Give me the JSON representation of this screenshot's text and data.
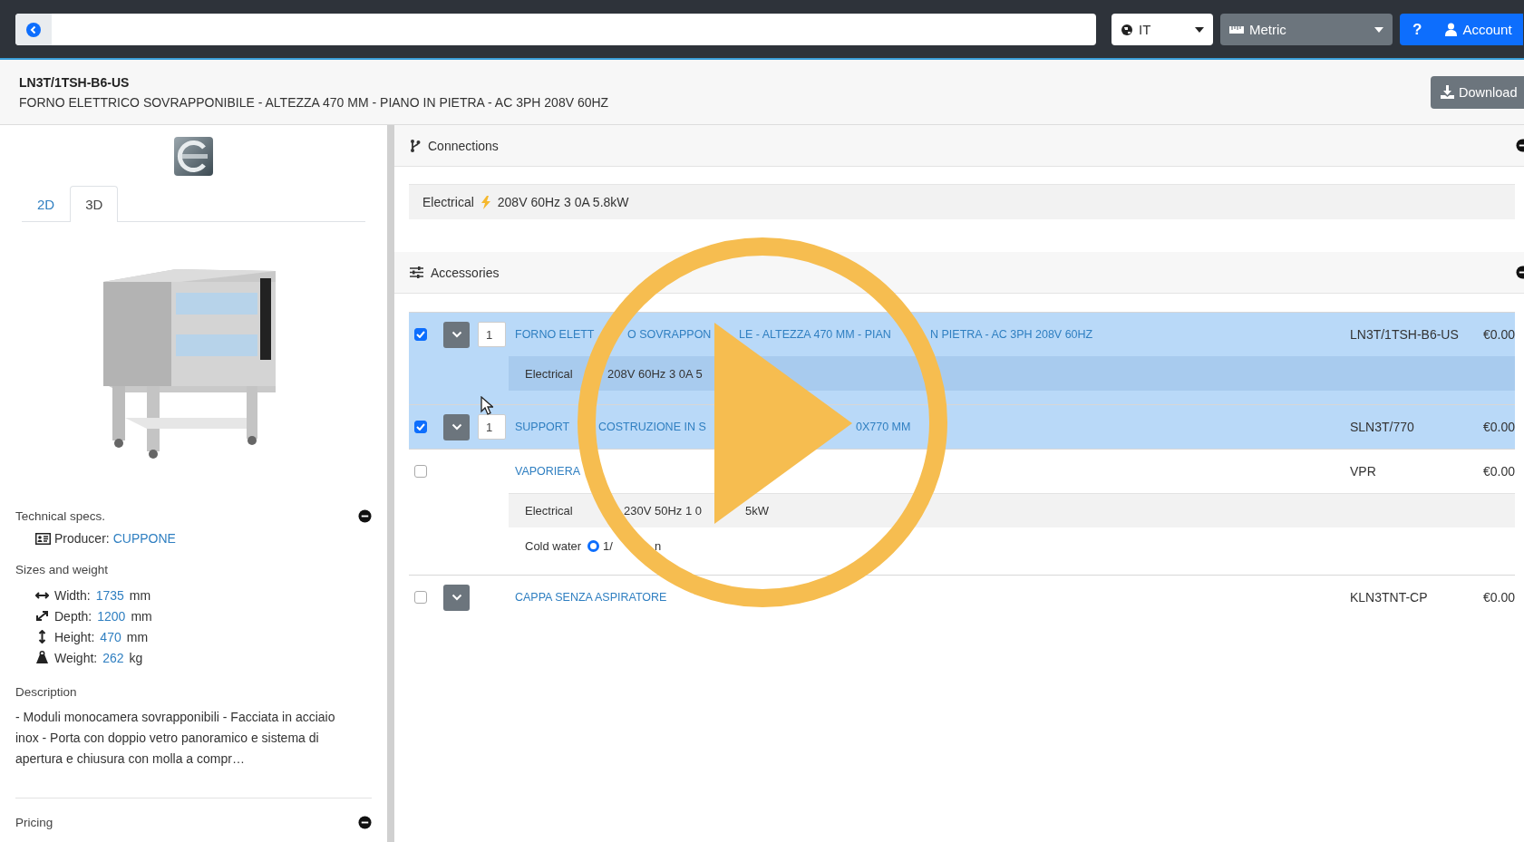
{
  "top_bar": {
    "language": "IT",
    "units": "Metric",
    "help": "?",
    "account": "Account"
  },
  "product": {
    "code": "LN3T/1TSH-B6-US",
    "name": "FORNO ELETTRICO SOVRAPPONIBILE - ALTEZZA 470 MM - PIANO IN PIETRA - AC 3PH 208V 60HZ",
    "download": "Download"
  },
  "viewer_tabs": [
    {
      "label": "2D",
      "selected": false
    },
    {
      "label": "3D",
      "selected": true
    }
  ],
  "technical_specs": {
    "title": "Technical specs.",
    "expanded": true,
    "producer_label": "Producer:",
    "producer": "CUPPONE"
  },
  "sizes": {
    "title": "Sizes and weight",
    "items": [
      {
        "kind": "width",
        "label": "Width:",
        "value": "1735",
        "unit": "mm"
      },
      {
        "kind": "depth",
        "label": "Depth:",
        "value": "1200",
        "unit": "mm"
      },
      {
        "kind": "height",
        "label": "Height:",
        "value": "470",
        "unit": "mm"
      },
      {
        "kind": "weight",
        "label": "Weight:",
        "value": "262",
        "unit": "kg"
      }
    ]
  },
  "description": {
    "title": "Description",
    "text": "- Moduli monocamera sovrapponibili - Facciata in acciaio inox - Porta con doppio vetro panoramico e sistema di apertura e chiusura con molla a compr…"
  },
  "pricing": {
    "title": "Pricing",
    "expanded": true
  },
  "connections": {
    "title": "Connections",
    "expanded": true,
    "items": [
      {
        "label": "Electrical",
        "value": "208V 60Hz 3 0A 5.8kW"
      }
    ]
  },
  "accessories": {
    "title": "Accessories",
    "expanded": true,
    "rows": [
      {
        "checked": true,
        "toggle": true,
        "quantity": "1",
        "title_parts": [
          "FORNO ELETT",
          "O SOVRAPPON",
          "LE - ALTEZZA 470 MM - PIAN",
          "N PIETRA - AC 3PH 208V 60HZ"
        ],
        "code": "LN3T/1TSH-B6-US",
        "price": "€0.00",
        "details": [
          {
            "kind": "electrical",
            "label": "Electrical",
            "parts": [
              "208V 60Hz 3 0A 5"
            ]
          }
        ]
      },
      {
        "checked": true,
        "toggle": true,
        "quantity": "1",
        "title_parts": [
          "SUPPORT",
          "COSTRUZIONE IN S",
          "0X770 MM"
        ],
        "code": "SLN3T/770",
        "price": "€0.00",
        "details": []
      },
      {
        "checked": false,
        "toggle": false,
        "title_parts": [
          "VAPORIERA"
        ],
        "code": "VPR",
        "price": "€0.00",
        "details": [
          {
            "kind": "electrical",
            "label": "Electrical",
            "parts": [
              "230V 50Hz 1 0",
              "5kW"
            ]
          },
          {
            "kind": "water",
            "label": "Cold water",
            "parts": [
              "1/",
              "n"
            ]
          }
        ]
      },
      {
        "checked": false,
        "toggle": true,
        "title_parts": [
          "CAPPA SENZA ASPIRATORE"
        ],
        "code": "KLN3TNT-CP",
        "price": "€0.00",
        "details": []
      }
    ]
  }
}
